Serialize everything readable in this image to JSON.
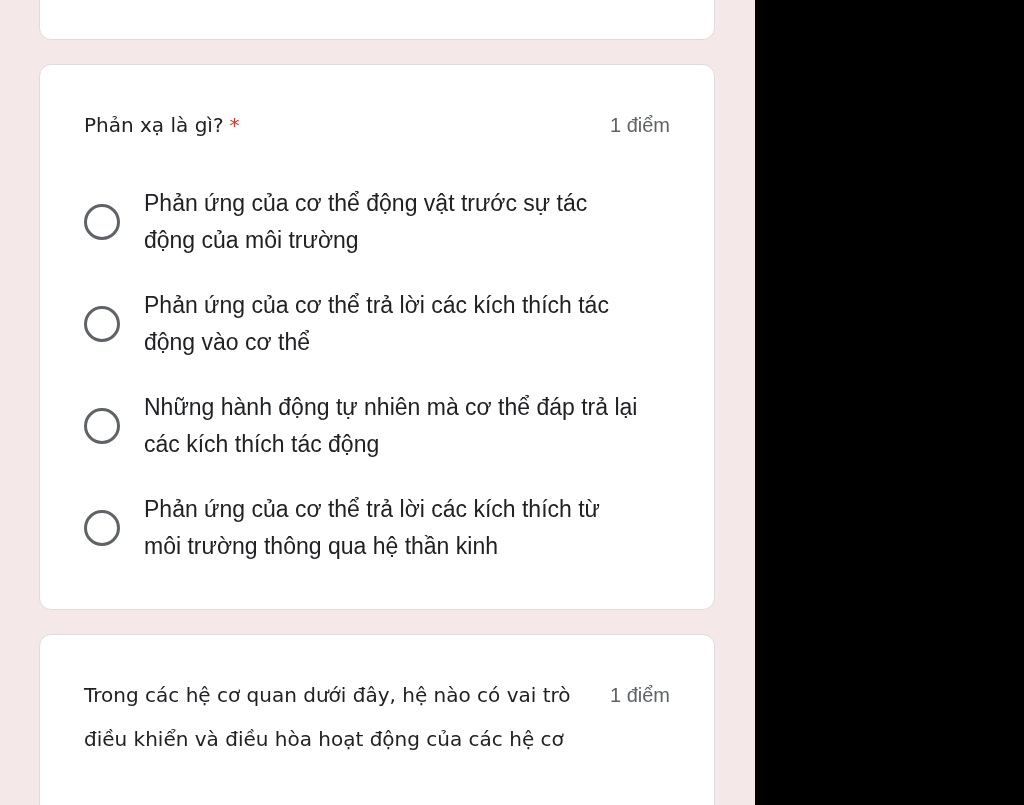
{
  "questions": [
    {
      "title": "Phản xạ là gì?",
      "required_mark": "*",
      "points": "1 điểm",
      "options": [
        {
          "label": "Phản ứng của cơ thể động vật trước sự tác động của môi trường",
          "selected": false
        },
        {
          "label": "Phản ứng của cơ thể trả lời các kích thích tác động vào cơ thể",
          "selected": false
        },
        {
          "label": "Những hành động tự nhiên mà cơ thể đáp trả lại các kích thích tác động",
          "selected": false
        },
        {
          "label": "Phản ứng của cơ thể trả lời các kích thích từ môi trường thông qua hệ thần kinh",
          "selected": false
        }
      ]
    },
    {
      "title": "Trong các hệ cơ quan dưới đây, hệ nào có vai trò điều khiển và điều hòa hoạt động của các hệ cơ",
      "points": "1 điểm"
    }
  ]
}
